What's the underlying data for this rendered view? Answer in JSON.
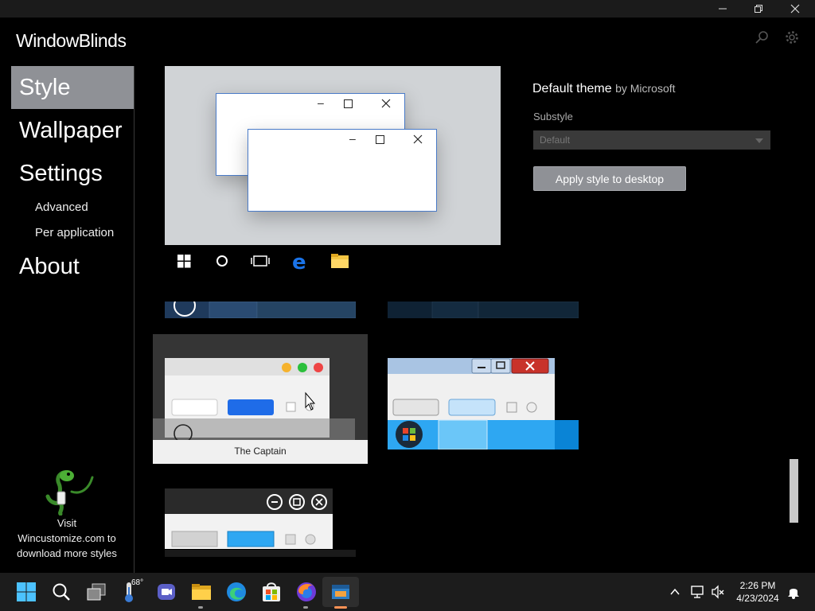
{
  "app": {
    "title": "WindowBlinds"
  },
  "nav": {
    "style": "Style",
    "wallpaper": "Wallpaper",
    "settings": "Settings",
    "advanced": "Advanced",
    "per_application": "Per application",
    "about": "About"
  },
  "promo": {
    "line1": "Visit",
    "line2": "Wincustomize.com to",
    "line3": "download more styles"
  },
  "theme": {
    "name": "Default theme",
    "author": "by Microsoft",
    "substyle_label": "Substyle",
    "substyle_value": "Default",
    "apply_label": "Apply style to desktop"
  },
  "styles": {
    "captain_label": "The Captain"
  },
  "taskbar": {
    "weather_temp": "68°",
    "time": "2:26 PM",
    "date": "4/23/2024"
  },
  "colors": {
    "accent_gray": "#8f9196",
    "taskbar": "#1c1c1c",
    "preview_bg": "#d0d3d6",
    "selection_blue": "#4a7bc8"
  }
}
